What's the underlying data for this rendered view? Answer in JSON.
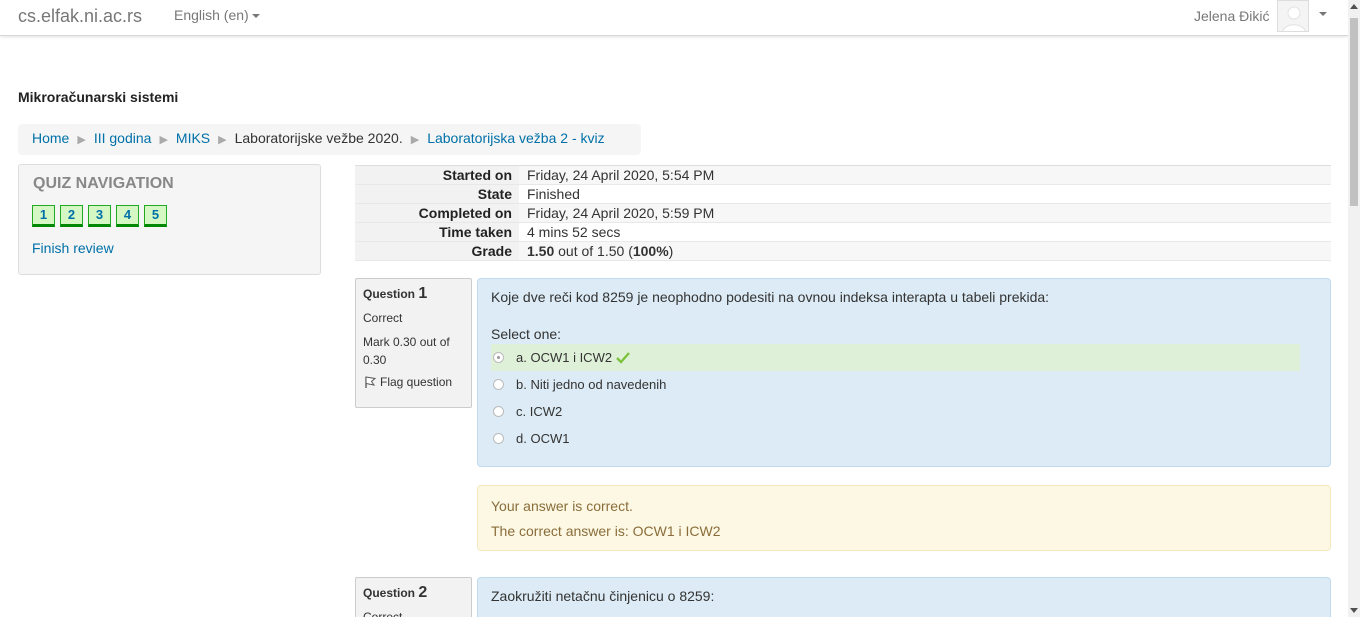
{
  "navbar": {
    "brand": "cs.elfak.ni.ac.rs",
    "language": "English (en)",
    "user_name": "Jelena Đikić"
  },
  "course": {
    "title": "Mikroračunarski sistemi"
  },
  "breadcrumb": [
    {
      "label": "Home",
      "link": true
    },
    {
      "label": "III godina",
      "link": true
    },
    {
      "label": "MIKS",
      "link": true
    },
    {
      "label": "Laboratorijske vežbe 2020.",
      "link": false
    },
    {
      "label": "Laboratorijska vežba 2 - kviz",
      "link": true
    }
  ],
  "quiz_nav": {
    "title": "QUIZ NAVIGATION",
    "questions": [
      "1",
      "2",
      "3",
      "4",
      "5"
    ],
    "finish_label": "Finish review"
  },
  "summary": {
    "rows": [
      {
        "label": "Started on",
        "value": "Friday, 24 April 2020, 5:54 PM"
      },
      {
        "label": "State",
        "value": "Finished"
      },
      {
        "label": "Completed on",
        "value": "Friday, 24 April 2020, 5:59 PM"
      },
      {
        "label": "Time taken",
        "value": "4 mins 52 secs"
      }
    ],
    "grade_label": "Grade",
    "grade_score": "1.50",
    "grade_out_of": " out of 1.50 (",
    "grade_percent": "100%",
    "grade_close": ")"
  },
  "question1": {
    "label": "Question ",
    "number": "1",
    "state": "Correct",
    "mark": "Mark 0.30 out of 0.30",
    "flag_label": "Flag question",
    "text": "Koje dve reči kod 8259 je neophodno podesiti na ovnou indeksa interapta u tabeli prekida:",
    "prompt": "Select one:",
    "options": [
      {
        "label": "a. OCW1 i ICW2",
        "selected": true,
        "correct": true
      },
      {
        "label": "b. Niti jedno od navedenih",
        "selected": false,
        "correct": false
      },
      {
        "label": "c. ICW2",
        "selected": false,
        "correct": false
      },
      {
        "label": "d. OCW1",
        "selected": false,
        "correct": false
      }
    ],
    "feedback_status": "Your answer is correct.",
    "feedback_right": "The correct answer is: OCW1 i ICW2"
  },
  "question2": {
    "label": "Question ",
    "number": "2",
    "state": "Correct",
    "text": "Zaokružiti netačnu činjenicu o 8259:"
  }
}
